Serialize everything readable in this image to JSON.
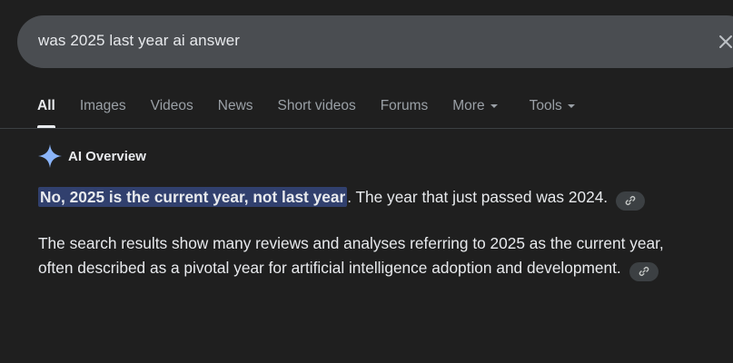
{
  "search": {
    "query": "was 2025 last year ai answer"
  },
  "tabs": [
    {
      "label": "All"
    },
    {
      "label": "Images"
    },
    {
      "label": "Videos"
    },
    {
      "label": "News"
    },
    {
      "label": "Short videos"
    },
    {
      "label": "Forums"
    },
    {
      "label": "More"
    },
    {
      "label": "Tools"
    }
  ],
  "ai_overview": {
    "title": "AI Overview",
    "answer_highlight": "No, 2025 is the current year, not last year",
    "answer_rest": ". The year that just passed was 2024.",
    "paragraph2": "The search results show many reviews and analyses referring to 2025 as the current year, often described as a pivotal year for artificial intelligence adoption and development."
  },
  "colors": {
    "background": "#1f1f1f",
    "search_bar": "#4a4d51",
    "highlight": "#31406e",
    "tab_inactive": "#9aa0a6",
    "sparkle": "#8ab4f8"
  },
  "icons": [
    "clear-icon",
    "chevron-down-icon",
    "sparkle-icon",
    "link-icon"
  ]
}
